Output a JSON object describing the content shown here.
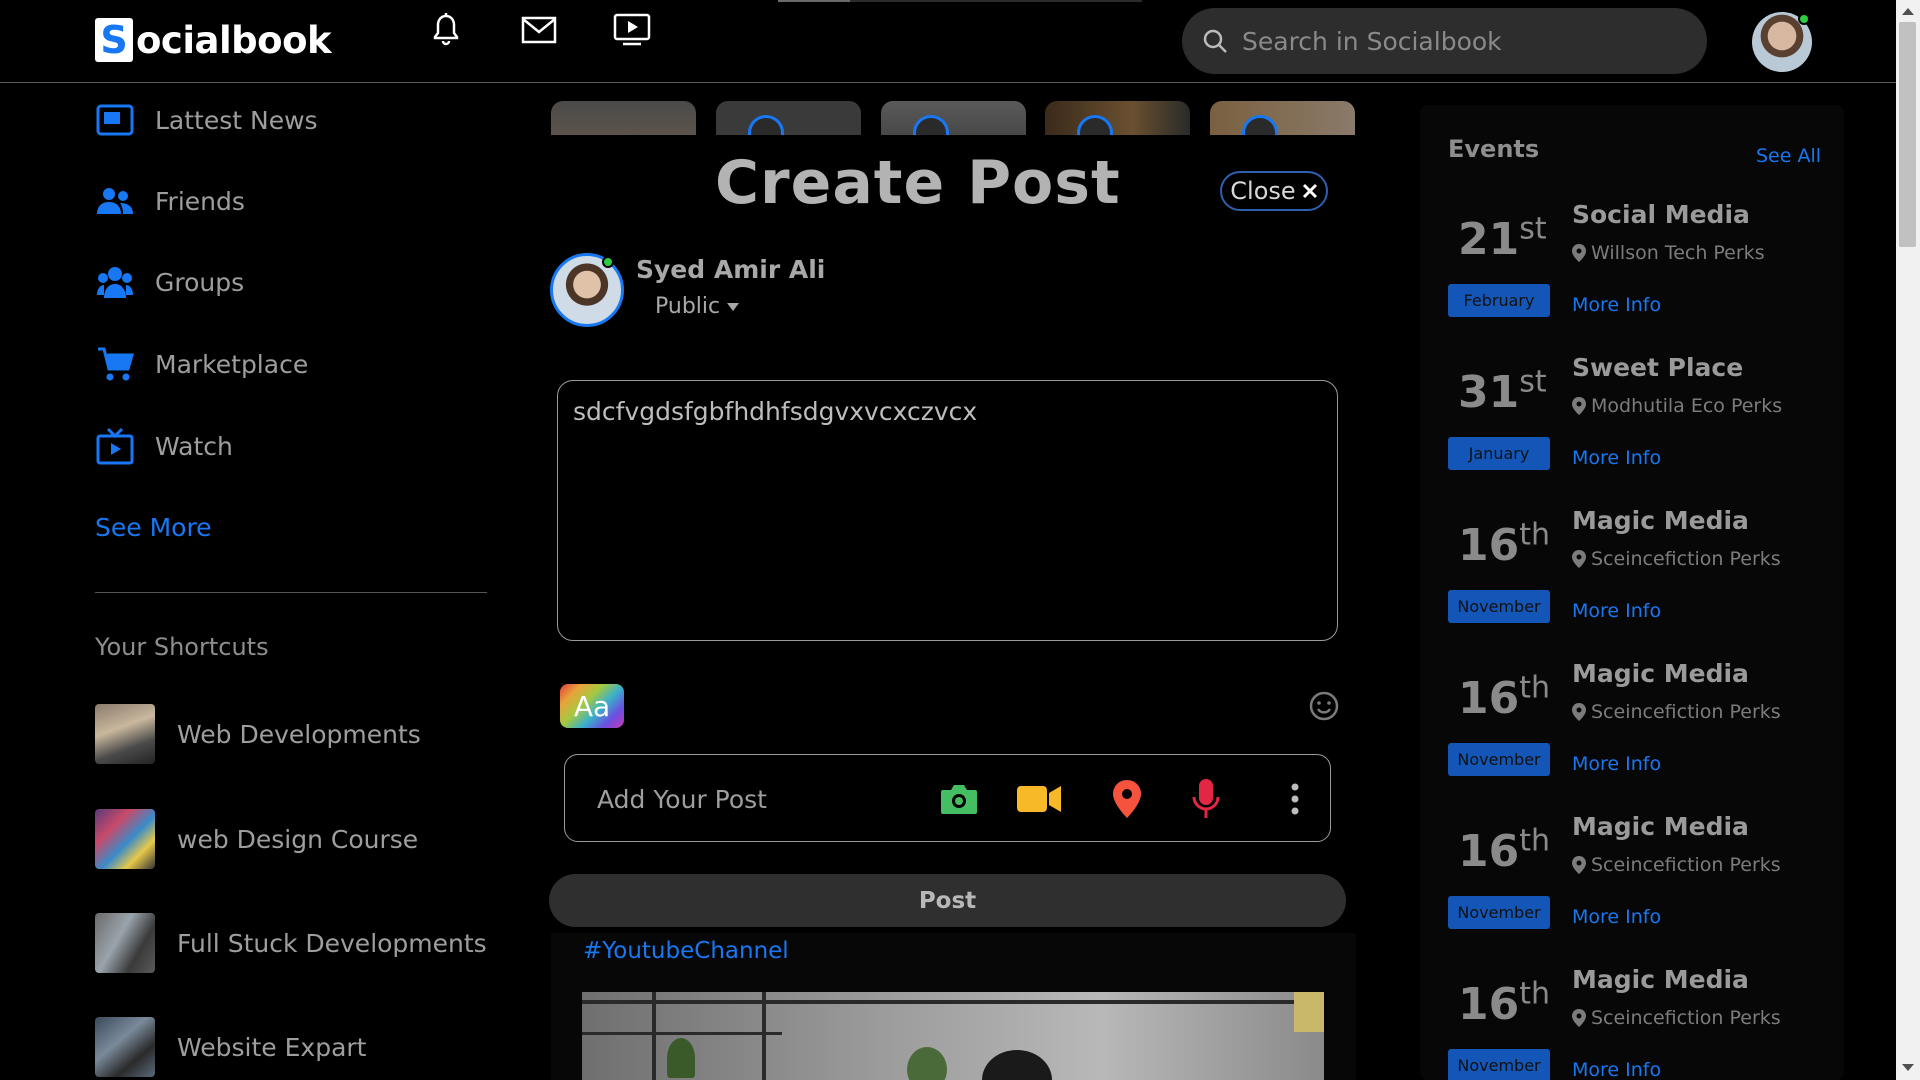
{
  "header": {
    "logo_letter": "S",
    "logo_rest": "ocialbook",
    "search_placeholder": "Search in Socialbook",
    "icons": [
      "bell-icon",
      "mail-icon",
      "video-play-icon",
      "search-icon"
    ]
  },
  "sidebar": {
    "items": [
      {
        "label": "Lattest News",
        "icon": "news-icon"
      },
      {
        "label": "Friends",
        "icon": "friends-icon"
      },
      {
        "label": "Groups",
        "icon": "groups-icon"
      },
      {
        "label": "Marketplace",
        "icon": "cart-icon"
      },
      {
        "label": "Watch",
        "icon": "watch-icon"
      }
    ],
    "see_more": "See More",
    "shortcuts_title": "Your Shortcuts",
    "shortcuts": [
      {
        "label": "Web Developments"
      },
      {
        "label": "web Design Course"
      },
      {
        "label": "Full Stuck Developments"
      },
      {
        "label": "Website Expart"
      }
    ]
  },
  "create_post": {
    "title": "Create Post",
    "close_label": "Close",
    "user_name": "Syed Amir Ali",
    "privacy": "Public",
    "text_value": "sdcfvgdsfgbfhdhfsdgvxvcxczvcx",
    "aa_label": "Aa",
    "add_post_label": "Add Your Post",
    "post_button": "Post",
    "tools": [
      "camera-icon",
      "video-camera-icon",
      "location-pin-icon",
      "microphone-icon",
      "more-vertical-icon"
    ]
  },
  "feed": {
    "hashtag": "#YoutubeChannel"
  },
  "events": {
    "title": "Events",
    "see_all": "See All",
    "more_info": "More Info",
    "items": [
      {
        "day": "21",
        "suffix": "st",
        "month": "February",
        "title": "Social Media",
        "location": "Willson Tech Perks"
      },
      {
        "day": "31",
        "suffix": "st",
        "month": "January",
        "title": "Sweet Place",
        "location": "Modhutila Eco Perks"
      },
      {
        "day": "16",
        "suffix": "th",
        "month": "November",
        "title": "Magic Media",
        "location": "Sceincefiction Perks"
      },
      {
        "day": "16",
        "suffix": "th",
        "month": "November",
        "title": "Magic Media",
        "location": "Sceincefiction Perks"
      },
      {
        "day": "16",
        "suffix": "th",
        "month": "November",
        "title": "Magic Media",
        "location": "Sceincefiction Perks"
      },
      {
        "day": "16",
        "suffix": "th",
        "month": "November",
        "title": "Magic Media",
        "location": "Sceincefiction Perks"
      }
    ]
  },
  "colors": {
    "accent": "#1877f2",
    "online": "#2ecc40",
    "camera": "#45bd62",
    "video": "#f7b928",
    "location": "#f5533d",
    "mic": "#e42645"
  }
}
